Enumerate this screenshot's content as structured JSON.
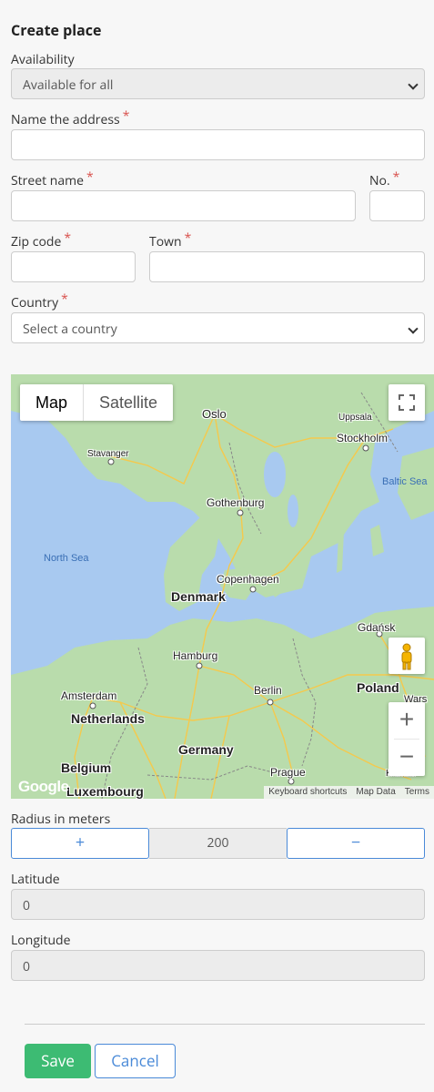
{
  "title": "Create place",
  "availability": {
    "label": "Availability",
    "value": "Available for all"
  },
  "name_address": {
    "label": "Name the address",
    "required": "*",
    "value": ""
  },
  "street": {
    "label": "Street name",
    "required": "*",
    "value": ""
  },
  "number": {
    "label": "No.",
    "required": "*",
    "value": ""
  },
  "zip": {
    "label": "Zip code",
    "required": "*",
    "value": ""
  },
  "town": {
    "label": "Town",
    "required": "*",
    "value": ""
  },
  "country": {
    "label": "Country",
    "required": "*",
    "value": "Select a country"
  },
  "map": {
    "map_type_buttons": [
      "Map",
      "Satellite"
    ],
    "places": {
      "oslo": "Oslo",
      "uppsala": "Uppsala",
      "stockholm": "Stockholm",
      "stavanger": "Stavanger",
      "gothenburg": "Gothenburg",
      "copenhagen": "Copenhagen",
      "denmark": "Denmark",
      "gdansk": "Gdańsk",
      "hamburg": "Hamburg",
      "berlin": "Berlin",
      "poland": "Poland",
      "amsterdam": "Amsterdam",
      "netherlands": "Netherlands",
      "germany": "Germany",
      "belgium": "Belgium",
      "luxembourg": "Luxembourg",
      "prague": "Prague",
      "warsaw": "Wars",
      "krakow": "Kraków"
    },
    "seas": {
      "north_sea": "North Sea",
      "baltic_sea": "Baltic Sea"
    },
    "logo": "Google",
    "attribution": [
      "Keyboard shortcuts",
      "Map Data",
      "Terms"
    ],
    "zoom_in": "+",
    "zoom_out": "−"
  },
  "radius": {
    "label": "Radius in meters",
    "plus": "+",
    "minus": "−",
    "value": "200"
  },
  "latitude": {
    "label": "Latitude",
    "value": "0"
  },
  "longitude": {
    "label": "Longitude",
    "value": "0"
  },
  "buttons": {
    "save": "Save",
    "cancel": "Cancel"
  },
  "colors": {
    "save": "#3dbb73",
    "link": "#4a8ad8",
    "required": "#d9534f",
    "water": "#a8c9f0",
    "land": "#bfe0b0"
  }
}
